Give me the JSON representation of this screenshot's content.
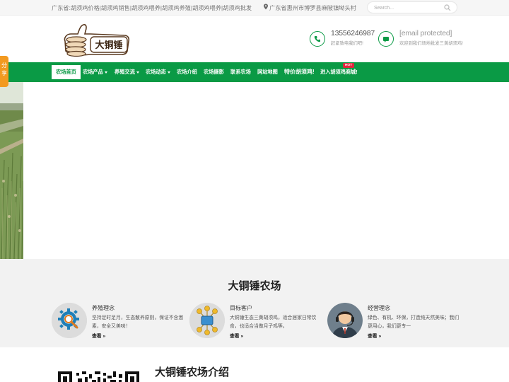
{
  "topbar": {
    "tagline": "广东省:胡须鸡价格|胡须鸡销售|胡须鸡喂养|胡须鸡养殖|胡须鸡喂养|胡须鸡批发",
    "address": "广东省惠州市博罗县麻陂镇坳头村",
    "search_placeholder": "Search..."
  },
  "header": {
    "logo_text": "大铜锤",
    "phone": "13556246987",
    "phone_sub": "赶紧致电我们吧!",
    "email": "[email protected]",
    "email_sub": "欢迎到我们场地批发三黄胡须鸡!"
  },
  "share": {
    "label": "分享"
  },
  "nav": {
    "items": [
      {
        "label": "农场首页"
      },
      {
        "label": "农场产品"
      },
      {
        "label": "养殖交流"
      },
      {
        "label": "农场动态"
      },
      {
        "label": "农场介绍"
      },
      {
        "label": "农场摄影"
      },
      {
        "label": "联系农场"
      },
      {
        "label": "网站地图"
      },
      {
        "label": "特价胡须鸡!"
      },
      {
        "label": "进入胡须鸡商城!"
      }
    ],
    "hot_badge": "HOT"
  },
  "section": {
    "title": "大铜锤农场",
    "features": [
      {
        "title": "养殖理念",
        "desc": "坚持足时足月，生态散养原则，保证不含激素，安全又美味！",
        "more": "查看 »",
        "icon": "gear-magnifier-icon"
      },
      {
        "title": "目标客户",
        "desc": "大铜锤生态三黄胡须鸡，适合居家日常饮食，也适合当做月子鸡等。",
        "more": "查看 »",
        "icon": "network-icon"
      },
      {
        "title": "经营理念",
        "desc": "绿色、有机、环保，打造纯天然美味；我们更用心，我们更专一",
        "more": "查看 »",
        "icon": "support-agent-icon"
      }
    ]
  },
  "bottom": {
    "intro_title": "大铜锤农场介绍"
  },
  "colors": {
    "brand_green": "#0a9a45",
    "share_orange": "#f39a20",
    "hot_red": "#e0263d"
  }
}
